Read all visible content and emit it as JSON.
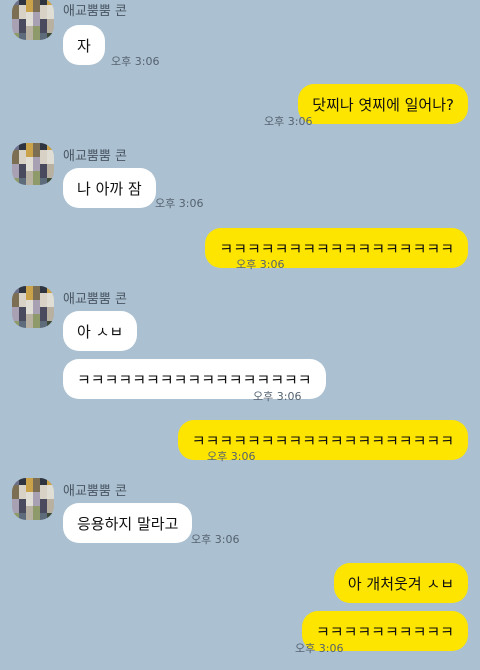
{
  "chat": {
    "sender_name": "애교뿜뿜 콘",
    "timestamp": "오후 3:06",
    "colors": {
      "background": "#abc0d1",
      "sent_bubble": "#fee500",
      "received_bubble": "#ffffff"
    }
  },
  "messages": [
    {
      "id": 1,
      "type": "received",
      "text": "자"
    },
    {
      "id": 2,
      "type": "sent",
      "text": "닷찌나 엿찌에 일어나?"
    },
    {
      "id": 3,
      "type": "received",
      "text": "나 아까 잠"
    },
    {
      "id": 4,
      "type": "sent",
      "text": "ㅋㅋㅋㅋㅋㅋㅋㅋㅋㅋㅋㅋㅋㅋㅋㅋㅋ"
    },
    {
      "id": 5,
      "type": "received",
      "text": "아 ㅅㅂ"
    },
    {
      "id": 6,
      "type": "received",
      "text": "ㅋㅋㅋㅋㅋㅋㅋㅋㅋㅋㅋㅋㅋㅋㅋㅋㅋ"
    },
    {
      "id": 7,
      "type": "sent",
      "text": "ㅋㅋㅋㅋㅋㅋㅋㅋㅋㅋㅋㅋㅋㅋㅋㅋㅋㅋㅋ"
    },
    {
      "id": 8,
      "type": "received",
      "text": "응용하지 말라고"
    },
    {
      "id": 9,
      "type": "sent",
      "text": "아 개처웃겨 ㅅㅂ"
    },
    {
      "id": 10,
      "type": "sent",
      "text": "ㅋㅋㅋㅋㅋㅋㅋㅋㅋㅋ"
    }
  ]
}
